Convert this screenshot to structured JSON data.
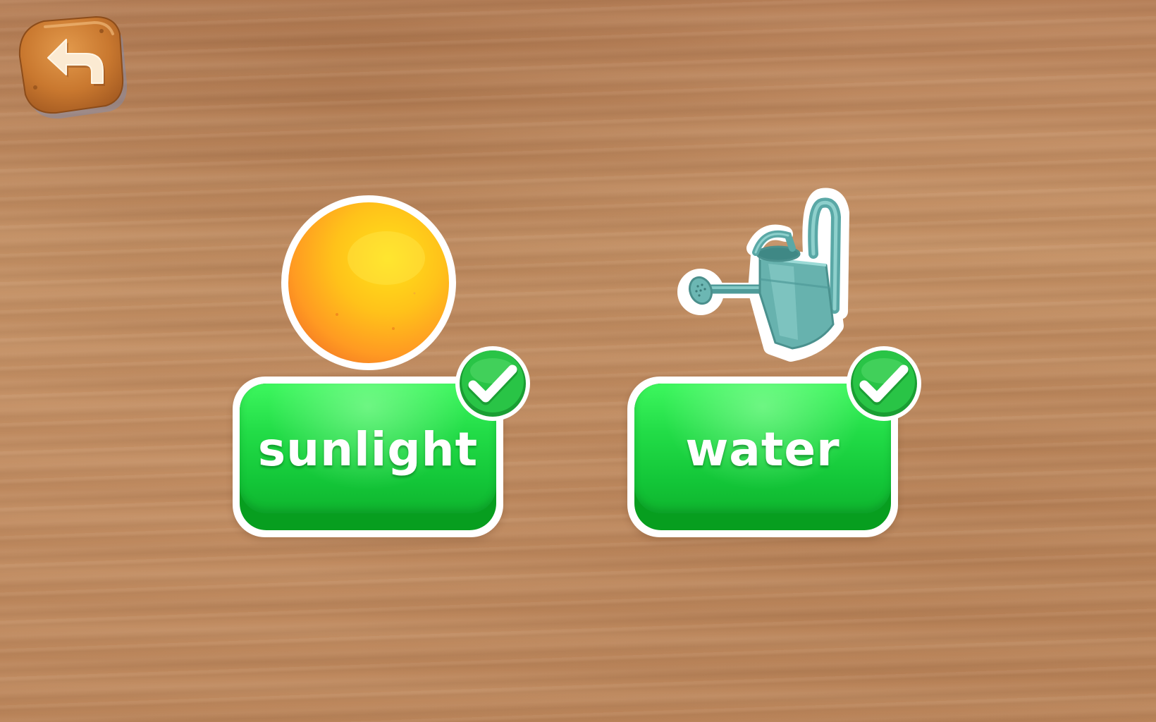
{
  "navigation": {
    "back_button": {
      "icon": "back-arrow-icon"
    }
  },
  "cards": [
    {
      "picture_icon": "sun-icon",
      "label": "sunlight",
      "status_icon": "checkmark-icon",
      "status": "correct"
    },
    {
      "picture_icon": "watering-can-icon",
      "label": "water",
      "status_icon": "checkmark-icon",
      "status": "correct"
    }
  ],
  "colors": {
    "button_green": "#22dc47",
    "button_green_dark": "#079e1f",
    "check_green": "#1fbf3c",
    "back_button_orange": "#d07f35",
    "wood_background": "#c28e64"
  }
}
